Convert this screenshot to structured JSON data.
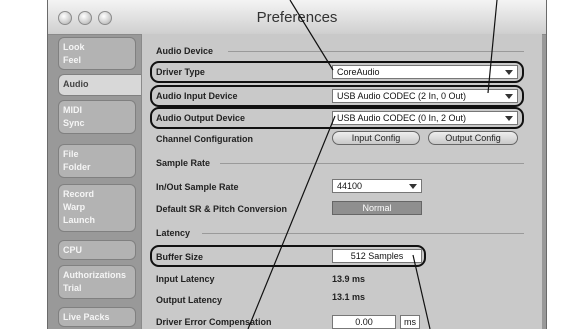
{
  "window": {
    "title": "Preferences"
  },
  "sidebar": {
    "tabs": [
      {
        "lines": [
          "Look",
          "Feel"
        ]
      },
      {
        "lines": [
          "Audio"
        ]
      },
      {
        "lines": [
          "MIDI",
          "Sync"
        ]
      },
      {
        "lines": [
          "File",
          "Folder"
        ]
      },
      {
        "lines": [
          "Record",
          "Warp",
          "Launch"
        ]
      },
      {
        "lines": [
          "CPU"
        ]
      },
      {
        "lines": [
          "Authorizations",
          "Trial"
        ]
      },
      {
        "lines": [
          "Live Packs"
        ]
      }
    ],
    "active_index": 1
  },
  "audio_device": {
    "heading": "Audio Device",
    "driver_type": {
      "label": "Driver Type",
      "value": "CoreAudio"
    },
    "input_device": {
      "label": "Audio Input Device",
      "value": "USB Audio CODEC  (2 In, 0 Out)"
    },
    "output_device": {
      "label": "Audio Output Device",
      "value": "USB Audio CODEC  (0 In, 2 Out)"
    },
    "channel_config": {
      "label": "Channel Configuration",
      "input_button": "Input Config",
      "output_button": "Output Config"
    }
  },
  "sample_rate": {
    "heading": "Sample Rate",
    "in_out": {
      "label": "In/Out Sample Rate",
      "value": "44100"
    },
    "default_sr": {
      "label": "Default SR & Pitch Conversion",
      "value": "Normal"
    }
  },
  "latency": {
    "heading": "Latency",
    "buffer_size": {
      "label": "Buffer Size",
      "value": "512 Samples"
    },
    "input_latency": {
      "label": "Input Latency",
      "value": "13.9 ms"
    },
    "output_latency": {
      "label": "Output Latency",
      "value": "13.1 ms"
    },
    "driver_error": {
      "label": "Driver Error Compensation",
      "value": "0.00",
      "unit": "ms"
    }
  }
}
